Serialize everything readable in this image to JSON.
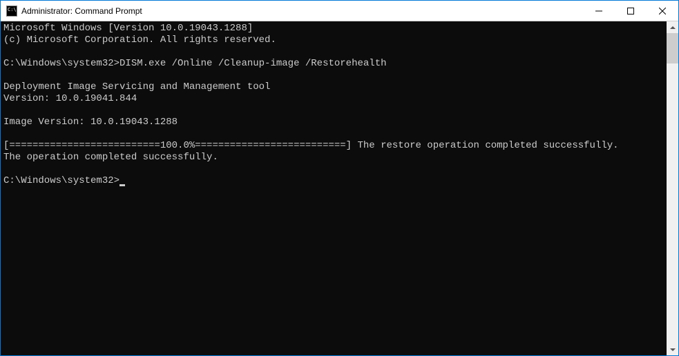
{
  "window": {
    "title": "Administrator: Command Prompt"
  },
  "console": {
    "lines": [
      "Microsoft Windows [Version 10.0.19043.1288]",
      "(c) Microsoft Corporation. All rights reserved.",
      "",
      "C:\\Windows\\system32>DISM.exe /Online /Cleanup-image /Restorehealth",
      "",
      "Deployment Image Servicing and Management tool",
      "Version: 10.0.19041.844",
      "",
      "Image Version: 10.0.19043.1288",
      "",
      "[==========================100.0%==========================] The restore operation completed successfully.",
      "The operation completed successfully.",
      ""
    ],
    "prompt": "C:\\Windows\\system32>"
  }
}
